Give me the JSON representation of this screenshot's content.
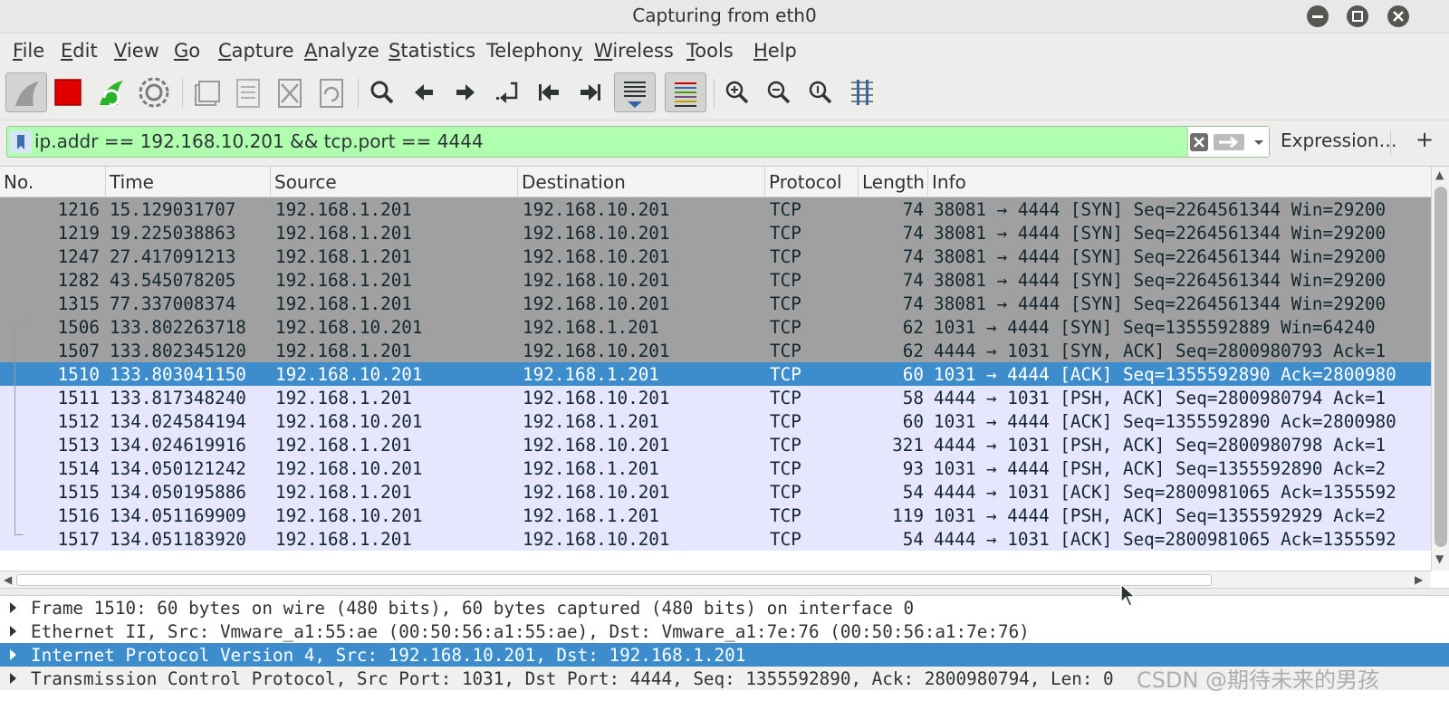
{
  "window": {
    "title": "Capturing from eth0"
  },
  "menu": [
    {
      "label": "File",
      "u": "F",
      "rest": "ile"
    },
    {
      "label": "Edit",
      "u": "E",
      "rest": "dit"
    },
    {
      "label": "View",
      "u": "V",
      "rest": "iew"
    },
    {
      "label": "Go",
      "u": "G",
      "rest": "o"
    },
    {
      "label": "Capture",
      "u": "C",
      "rest": "apture"
    },
    {
      "label": "Analyze",
      "u": "A",
      "rest": "nalyze"
    },
    {
      "label": "Statistics",
      "u": "S",
      "rest": "tatistics"
    },
    {
      "label": "Telephony",
      "u": "y",
      "rest": ""
    },
    {
      "label": "Wireless",
      "u": "W",
      "rest": "ireless"
    },
    {
      "label": "Tools",
      "u": "T",
      "rest": "ools"
    },
    {
      "label": "Help",
      "u": "H",
      "rest": "elp"
    }
  ],
  "filter": {
    "value": "ip.addr == 192.168.10.201 && tcp.port == 4444",
    "expression_label": "Expression…",
    "add_label": "+",
    "bg_color": "#afffaf"
  },
  "columns": [
    "No.",
    "Time",
    "Source",
    "Destination",
    "Protocol",
    "Length",
    "Info"
  ],
  "packets": [
    {
      "no": "1216",
      "time": "15.129031707",
      "src": "192.168.1.201",
      "dst": "192.168.10.201",
      "proto": "TCP",
      "len": "74",
      "info": "38081 → 4444 [SYN] Seq=2264561344 Win=29200",
      "style": "gray"
    },
    {
      "no": "1219",
      "time": "19.225038863",
      "src": "192.168.1.201",
      "dst": "192.168.10.201",
      "proto": "TCP",
      "len": "74",
      "info": "38081 → 4444 [SYN] Seq=2264561344 Win=29200",
      "style": "gray"
    },
    {
      "no": "1247",
      "time": "27.417091213",
      "src": "192.168.1.201",
      "dst": "192.168.10.201",
      "proto": "TCP",
      "len": "74",
      "info": "38081 → 4444 [SYN] Seq=2264561344 Win=29200",
      "style": "gray"
    },
    {
      "no": "1282",
      "time": "43.545078205",
      "src": "192.168.1.201",
      "dst": "192.168.10.201",
      "proto": "TCP",
      "len": "74",
      "info": "38081 → 4444 [SYN] Seq=2264561344 Win=29200",
      "style": "gray"
    },
    {
      "no": "1315",
      "time": "77.337008374",
      "src": "192.168.1.201",
      "dst": "192.168.10.201",
      "proto": "TCP",
      "len": "74",
      "info": "38081 → 4444 [SYN] Seq=2264561344 Win=29200",
      "style": "gray"
    },
    {
      "no": "1506",
      "time": "133.802263718",
      "src": "192.168.10.201",
      "dst": "192.168.1.201",
      "proto": "TCP",
      "len": "62",
      "info": "1031 → 4444 [SYN] Seq=1355592889 Win=64240",
      "style": "gray"
    },
    {
      "no": "1507",
      "time": "133.802345120",
      "src": "192.168.1.201",
      "dst": "192.168.10.201",
      "proto": "TCP",
      "len": "62",
      "info": "4444 → 1031 [SYN, ACK] Seq=2800980793 Ack=1",
      "style": "gray"
    },
    {
      "no": "1510",
      "time": "133.803041150",
      "src": "192.168.10.201",
      "dst": "192.168.1.201",
      "proto": "TCP",
      "len": "60",
      "info": "1031 → 4444 [ACK] Seq=1355592890 Ack=2800980",
      "style": "sel"
    },
    {
      "no": "1511",
      "time": "133.817348240",
      "src": "192.168.1.201",
      "dst": "192.168.10.201",
      "proto": "TCP",
      "len": "58",
      "info": "4444 → 1031 [PSH, ACK] Seq=2800980794 Ack=1",
      "style": "lav"
    },
    {
      "no": "1512",
      "time": "134.024584194",
      "src": "192.168.10.201",
      "dst": "192.168.1.201",
      "proto": "TCP",
      "len": "60",
      "info": "1031 → 4444 [ACK] Seq=1355592890 Ack=2800980",
      "style": "lav"
    },
    {
      "no": "1513",
      "time": "134.024619916",
      "src": "192.168.1.201",
      "dst": "192.168.10.201",
      "proto": "TCP",
      "len": "321",
      "info": "4444 → 1031 [PSH, ACK] Seq=2800980798 Ack=1",
      "style": "lav"
    },
    {
      "no": "1514",
      "time": "134.050121242",
      "src": "192.168.10.201",
      "dst": "192.168.1.201",
      "proto": "TCP",
      "len": "93",
      "info": "1031 → 4444 [PSH, ACK] Seq=1355592890 Ack=2",
      "style": "lav"
    },
    {
      "no": "1515",
      "time": "134.050195886",
      "src": "192.168.1.201",
      "dst": "192.168.10.201",
      "proto": "TCP",
      "len": "54",
      "info": "4444 → 1031 [ACK] Seq=2800981065 Ack=1355592",
      "style": "lav"
    },
    {
      "no": "1516",
      "time": "134.051169909",
      "src": "192.168.10.201",
      "dst": "192.168.1.201",
      "proto": "TCP",
      "len": "119",
      "info": "1031 → 4444 [PSH, ACK] Seq=1355592929 Ack=2",
      "style": "lav"
    },
    {
      "no": "1517",
      "time": "134.051183920",
      "src": "192.168.1.201",
      "dst": "192.168.10.201",
      "proto": "TCP",
      "len": "54",
      "info": "4444 → 1031 [ACK] Seq=2800981065 Ack=1355592",
      "style": "lav"
    }
  ],
  "details": [
    {
      "text": "Frame 1510: 60 bytes on wire (480 bits), 60 bytes captured (480 bits) on interface 0",
      "style": "normal"
    },
    {
      "text": "Ethernet II, Src: Vmware_a1:55:ae (00:50:56:a1:55:ae), Dst: Vmware_a1:7e:76 (00:50:56:a1:7e:76)",
      "style": "normal"
    },
    {
      "text": "Internet Protocol Version 4, Src: 192.168.10.201, Dst: 192.168.1.201",
      "style": "sel"
    },
    {
      "text": "Transmission Control Protocol, Src Port: 1031, Dst Port: 4444, Seq: 1355592890, Ack: 2800980794, Len: 0",
      "style": "hl"
    }
  ],
  "watermark": "CSDN @期待未来的男孩",
  "colors": {
    "selected": "#3d8ccb",
    "gray_row": "#a0a0a0",
    "lavender_row": "#e7e6ff",
    "capture_stop": "#e00000",
    "restart_green": "#2bb52b"
  }
}
